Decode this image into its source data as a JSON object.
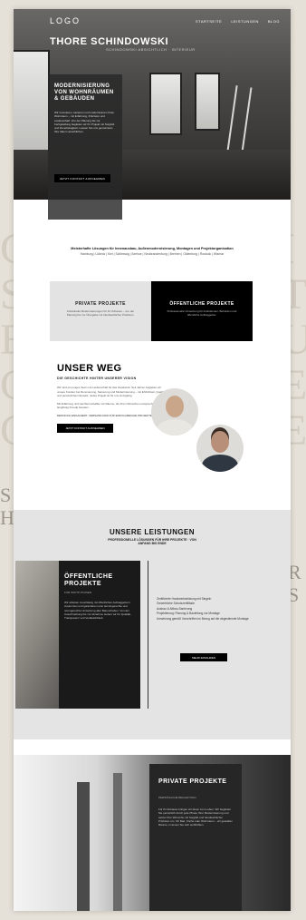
{
  "nav": {
    "logo": "LOGO",
    "links": [
      "STARTSEITE",
      "LEISTUNGEN",
      "BLOG"
    ]
  },
  "hero": {
    "title": "THORE SCHINDOWSKI",
    "subtitle": "SCHINDOWSKI ABSICHTLICH · INTERIEUR",
    "card_heading": "MODERNISIERUNG VON WOHNRÄUMEN & GEBÄUDEN",
    "card_text": "Wir renovieren, sanieren und modernisieren Ihren Wohnraum – mit Erfahrung, Präzision und Leidenschaft. Von der Planung bis zur Fertigstellung begleiten wir Ihr Projekt mit Sorgfalt und Zuverlässigkeit. Lassen Sie uns gemeinsam Ihre Ideen verwirklichen.",
    "cta": "JETZT KONTAKT AUFNEHMEN"
  },
  "tagline": {
    "line1": "Meisterhafte Lösungen für Innenausbau, Außenmodernisierung, Montagen und Projektorganisation",
    "line2": "Hamburg | Lübeck | Kiel | Schleswig | Itzehoe | Neubrandenburg | Bremen | Oldenburg | Rostock | Wismar"
  },
  "cards": [
    {
      "title": "PRIVATE PROJEKTE",
      "text": "Individuelle Modernisierungen für Ihr Zuhause – von der Planung bis zur Übergabe mit handwerklicher Präzision."
    },
    {
      "title": "ÖFFENTLICHE PROJEKTE",
      "text": "Professionelle Umsetzung für Institutionen, Behörden und öffentliche Auftraggeber."
    }
  ],
  "about": {
    "title": "UNSER WEG",
    "subtitle": "DIE GESCHICHTE HINTER UNSERER VISION",
    "text1": "Wir sind ein junges Team mit Leidenschaft für das Handwerk. Seit Jahren begleiten wir unsere Kunden bei Renovierung, Sanierung und Modernisierung – mit Ehrlichkeit, Qualität und persönlichem Einsatz. Jedes Projekt ist für uns einzigartig.",
    "text2": "Mit Erfahrung und Herzblut schaffen wir Räume, die Ihren Wünschen entsprechen und langfristig Freude bereiten.",
    "text3": "DENNOCH ENGAGIERT. VERSAND-RAD FÜR ERFOLGREICHE PROJEKTE.",
    "cta": "JETZT KONTAKT AUFNEHMEN"
  },
  "services": {
    "title": "UNSERE LEISTUNGEN",
    "subtitle": "PROFESSIONELLE LÖSUNGEN FÜR IHRE PROJEKTE · VON ANFANG BIS ENDE",
    "card_title": "ÖFFENTLICHE PROJEKTE",
    "card_kicker": "FÜR INSTITUTIONEN",
    "card_text": "Wir arbeiten zuverlässig mit öffentlichen Auftraggebern zusammen und garantieren eine termingerechte und normgerechte Umsetzung aller Bauvorhaben. Von der Ausschreibung bis zur Abnahme stehen wir für Qualität, Transparenz und Verlässlichkeit.",
    "list": [
      "Zertifizierte Handwerksleistung mit Siegeln",
      "Gewerbliche Schutzzertifikate",
      "Ausbau & Altbau-Sanierung",
      "Projektierung: Planung & Bauleitung vor Montage",
      "Umsetzung gemäß Vorschriften im Bezug auf die abgestimmte Montage"
    ],
    "cta": "MEHR ERFAHREN"
  },
  "private": {
    "title": "PRIVATE PROJEKTE",
    "kicker": "PERSÖNLICHE BEGLEITUNG",
    "text": "Für Ihr Zuhause bringen wir Ideen zum Leben. Wir begleiten Sie persönlich durch jede Phase Ihrer Modernisierung und setzen Ihre Wünsche mit Sorgfalt und handwerklicher Präzision um. Ob Bad, Küche oder Wohnraum – wir gestalten Räume, in denen Sie sich wohlfühlen."
  },
  "background_text": {
    "letters_left": [
      "C",
      "S",
      "E",
      "C",
      "G"
    ],
    "letters_right": [
      "I",
      "T",
      "U",
      "E",
      "E"
    ],
    "small_left": [
      "S",
      "H"
    ],
    "small_right": [
      "R",
      "S"
    ]
  }
}
